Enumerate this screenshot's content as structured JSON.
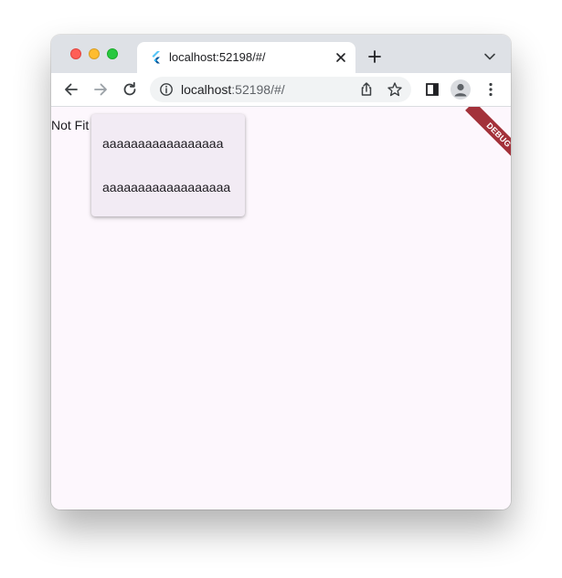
{
  "browser": {
    "tab": {
      "title": "localhost:52198/#/"
    },
    "address_bar": {
      "host": "localhost",
      "rest": ":52198/#/"
    },
    "icons": {
      "tab_favicon": "flutter-logo-icon",
      "tab_close": "close-icon",
      "new_tab": "plus-icon",
      "tab_list": "chevron-down-icon",
      "back": "arrow-left-icon",
      "forward": "arrow-right-icon",
      "reload": "reload-icon",
      "site_info": "info-icon",
      "share": "share-icon",
      "bookmark": "star-icon",
      "side_panel": "side-panel-icon",
      "profile": "profile-icon",
      "menu": "kebab-menu-icon"
    }
  },
  "app": {
    "label": "Not Fit",
    "menu": {
      "items": [
        "aaaaaaaaaaaaaaaaa",
        "aaaaaaaaaaaaaaaaaa"
      ]
    },
    "debug_banner": "DEBUG",
    "colors": {
      "background": "#fdf7fd",
      "menu_surface": "#f2ebf4",
      "debug_banner": "#a3313a"
    }
  }
}
